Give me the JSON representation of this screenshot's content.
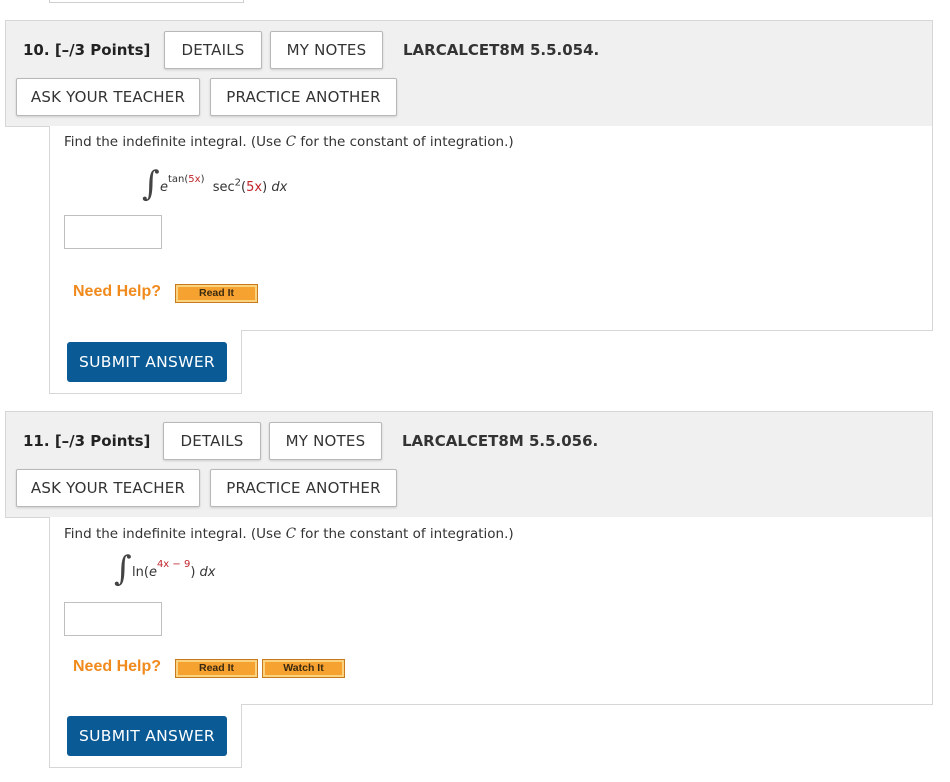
{
  "questions": [
    {
      "number": "10.",
      "points": "[–/3 Points]",
      "details_label": "DETAILS",
      "my_notes_label": "MY NOTES",
      "code": "LARCALCET8M 5.5.054.",
      "ask_teacher_label": "ASK YOUR TEACHER",
      "practice_another_label": "PRACTICE ANOTHER",
      "prompt_before": "Find the indefinite integral. (Use ",
      "prompt_var": "C",
      "prompt_after": " for the constant of integration.)",
      "integral": {
        "base": "e",
        "exponent_func": "tan",
        "exponent_open": "(",
        "exponent_arg": "5x",
        "exponent_close": ")",
        "func": "sec",
        "power": "2",
        "arg_open": "(",
        "arg": "5x",
        "arg_close": ")",
        "differential": "dx"
      },
      "answer_value": "",
      "need_help": "Need Help?",
      "help_buttons": [
        "Read It"
      ],
      "submit_label": "SUBMIT ANSWER"
    },
    {
      "number": "11.",
      "points": "[–/3 Points]",
      "details_label": "DETAILS",
      "my_notes_label": "MY NOTES",
      "code": "LARCALCET8M 5.5.056.",
      "ask_teacher_label": "ASK YOUR TEACHER",
      "practice_another_label": "PRACTICE ANOTHER",
      "prompt_before": "Find the indefinite integral. (Use ",
      "prompt_var": "C",
      "prompt_after": " for the constant of integration.)",
      "integral": {
        "func": "ln",
        "open": "(",
        "base": "e",
        "exponent": "4x − 9",
        "close": ")",
        "differential": "dx"
      },
      "answer_value": "",
      "need_help": "Need Help?",
      "help_buttons": [
        "Read It",
        "Watch It"
      ],
      "submit_label": "SUBMIT ANSWER"
    }
  ],
  "colors": {
    "submit": "#0a5a96",
    "need_help": "#f08a1c",
    "help_button": "#f6a230",
    "math_red": "#c0262c",
    "header_bg": "#f0f0f0"
  }
}
